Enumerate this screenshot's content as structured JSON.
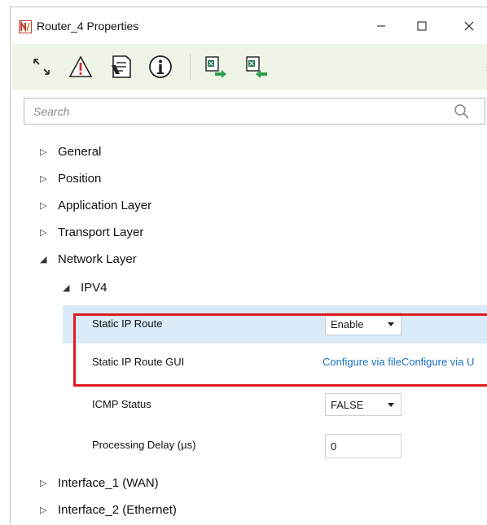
{
  "window": {
    "title": "Router_4 Properties",
    "controls": [
      "minimize",
      "maximize",
      "close"
    ]
  },
  "toolbar": {
    "buttons": [
      {
        "icon": "expand-collapse-icon"
      },
      {
        "icon": "warning-icon"
      },
      {
        "icon": "document-icon"
      },
      {
        "icon": "info-icon"
      },
      {
        "icon": "excel-export-icon"
      },
      {
        "icon": "excel-import-icon"
      }
    ]
  },
  "search": {
    "placeholder": "Search"
  },
  "tree": {
    "general": "General",
    "position": "Position",
    "application_layer": "Application Layer",
    "transport_layer": "Transport Layer",
    "network_layer": "Network Layer",
    "ipv4": "IPV4",
    "interface_1": "Interface_1 (WAN)",
    "interface_2": "Interface_2 (Ethernet)"
  },
  "properties": {
    "static_ip_route": {
      "label": "Static IP Route",
      "value": "Enable"
    },
    "static_ip_route_gui": {
      "label": "Static IP Route GUI",
      "value": "Configure via fileConfigure via U"
    },
    "icmp_status": {
      "label": "ICMP Status",
      "value": "FALSE"
    },
    "processing_delay": {
      "label": "Processing Delay (µs)",
      "value": "0"
    }
  },
  "colors": {
    "toolbar_bg": "#eef5e6",
    "selected_row": "#d9ebf8",
    "highlight_border": "#e01b22",
    "link": "#1c6fc4"
  }
}
